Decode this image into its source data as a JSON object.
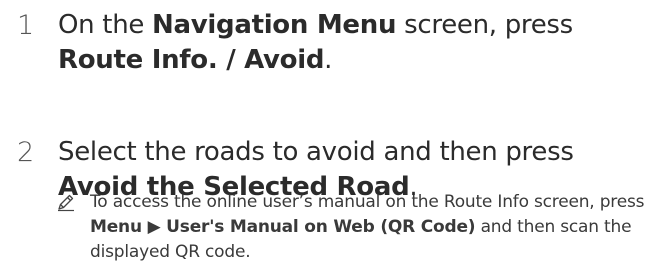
{
  "steps": [
    {
      "number": "1",
      "t1": "On the ",
      "b1": "Navigation Menu",
      "t2": " screen, press ",
      "b2": "Route Info. / Avoid",
      "t3": "."
    },
    {
      "number": "2",
      "t1": "Select the roads to avoid and then press ",
      "b1": "Avoid the Selected Road",
      "t2": "."
    }
  ],
  "note": {
    "icon": "pencil-icon",
    "t1": "To access the online user’s manual on the Route Info screen, press ",
    "b1": "Menu",
    "arrow": " ▶ ",
    "b2": "User's Manual on Web (QR Code)",
    "t2": " and then scan the displayed QR code."
  }
}
